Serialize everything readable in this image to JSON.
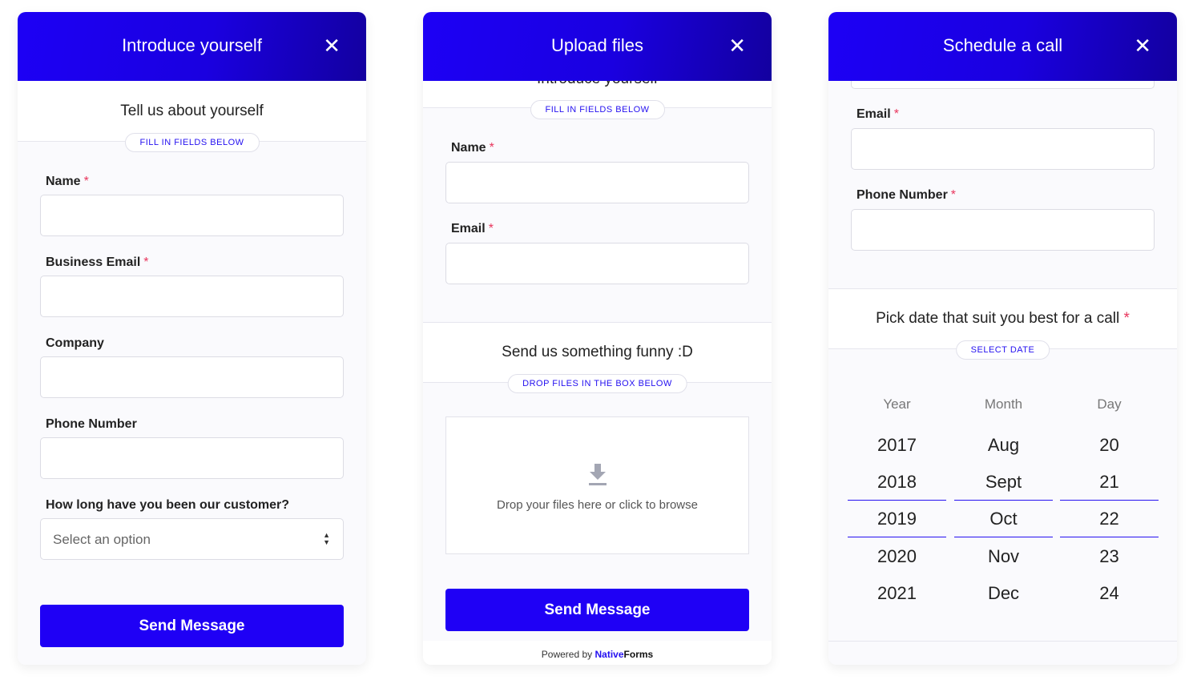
{
  "colors": {
    "accent": "#1f00f5",
    "required": "#e8365d"
  },
  "panels": [
    {
      "title": "Introduce yourself",
      "close_icon": "close-icon",
      "section_title": "Tell us about yourself",
      "badge": "FILL IN FIELDS BELOW",
      "fields": [
        {
          "label": "Name",
          "required": "*"
        },
        {
          "label": "Business Email",
          "required": "*"
        },
        {
          "label": "Company"
        },
        {
          "label": "Phone Number"
        },
        {
          "label": "How long have you been our customer?"
        }
      ],
      "select_placeholder": "Select an option",
      "submit": "Send Message"
    },
    {
      "title": "Upload files",
      "prev_section_title": "Introduce yourself",
      "badge": "FILL IN FIELDS BELOW",
      "fields": [
        {
          "label": "Name",
          "required": "*"
        },
        {
          "label": "Email",
          "required": "*"
        }
      ],
      "section_title": "Send us something funny :D",
      "badge2": "DROP FILES IN THE BOX BELOW",
      "drop_text": "Drop your files here or click to browse",
      "drop_icon": "download-icon",
      "submit": "Send Message",
      "powered_by": "Powered by",
      "brand_a": "Native",
      "brand_b": "Forms"
    },
    {
      "title": "Schedule a call",
      "fields": [
        {
          "label": "Email",
          "required": "*"
        },
        {
          "label": "Phone Number",
          "required": "*"
        }
      ],
      "section_title": "Pick date that suit you best for a call",
      "section_required": "*",
      "badge": "SELECT DATE",
      "picker": {
        "headers": [
          "Year",
          "Month",
          "Day"
        ],
        "years": [
          "2017",
          "2018",
          "2019",
          "2020",
          "2021"
        ],
        "months": [
          "Aug",
          "Sept",
          "Oct",
          "Nov",
          "Dec"
        ],
        "days": [
          "20",
          "21",
          "22",
          "23",
          "24"
        ],
        "selected": {
          "year": "2019",
          "month": "Oct",
          "day": "22"
        }
      }
    }
  ]
}
